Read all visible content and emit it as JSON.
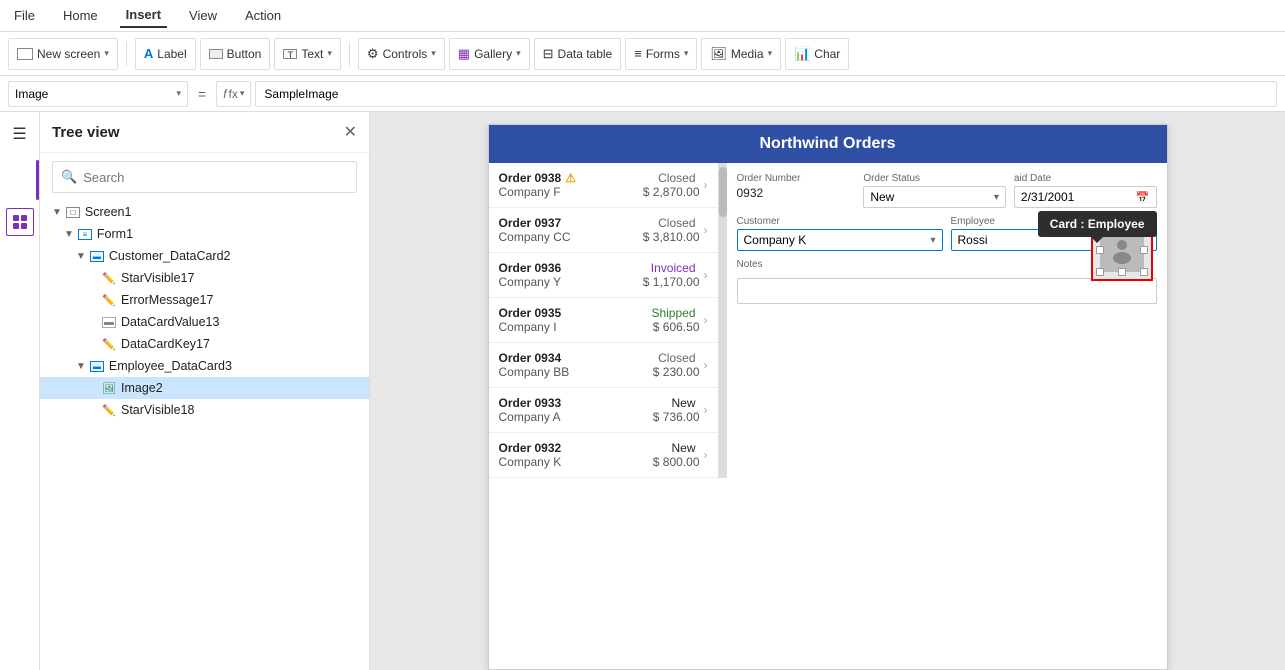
{
  "menuBar": {
    "items": [
      "File",
      "Home",
      "Insert",
      "View",
      "Action"
    ],
    "active": "Insert"
  },
  "toolbar": {
    "newScreen": "New screen",
    "label": "Label",
    "button": "Button",
    "text": "Text",
    "controls": "Controls",
    "gallery": "Gallery",
    "dataTable": "Data table",
    "forms": "Forms",
    "media": "Media",
    "chart": "Char"
  },
  "formulaBar": {
    "selector": "Image",
    "equals": "=",
    "fx": "fx",
    "value": "SampleImage"
  },
  "treeView": {
    "title": "Tree view",
    "search": {
      "placeholder": "Search"
    },
    "items": [
      {
        "id": "screen1",
        "label": "Screen1",
        "indent": 1,
        "type": "screen",
        "expanded": true
      },
      {
        "id": "form1",
        "label": "Form1",
        "indent": 2,
        "type": "form",
        "expanded": true
      },
      {
        "id": "customer_datacard2",
        "label": "Customer_DataCard2",
        "indent": 3,
        "type": "datacard",
        "expanded": true
      },
      {
        "id": "starvisible17",
        "label": "StarVisible17",
        "indent": 4,
        "type": "pencil"
      },
      {
        "id": "errormessage17",
        "label": "ErrorMessage17",
        "indent": 4,
        "type": "pencil"
      },
      {
        "id": "datacardvalue13",
        "label": "DataCardValue13",
        "indent": 4,
        "type": "textfield"
      },
      {
        "id": "datacardkey17",
        "label": "DataCardKey17",
        "indent": 4,
        "type": "pencil"
      },
      {
        "id": "employee_datacard3",
        "label": "Employee_DataCard3",
        "indent": 3,
        "type": "datacard",
        "expanded": true
      },
      {
        "id": "image2",
        "label": "Image2",
        "indent": 4,
        "type": "image",
        "active": true
      },
      {
        "id": "starvisible18",
        "label": "StarVisible18",
        "indent": 4,
        "type": "pencil"
      }
    ]
  },
  "app": {
    "title": "Northwind Orders",
    "orders": [
      {
        "num": "Order 0938",
        "company": "Company F",
        "status": "Closed",
        "statusClass": "closed",
        "amount": "$ 2,870.00",
        "warn": true
      },
      {
        "num": "Order 0937",
        "company": "Company CC",
        "status": "Closed",
        "statusClass": "closed",
        "amount": "$ 3,810.00",
        "warn": false
      },
      {
        "num": "Order 0936",
        "company": "Company Y",
        "status": "Invoiced",
        "statusClass": "invoiced",
        "amount": "$ 1,170.00",
        "warn": false
      },
      {
        "num": "Order 0935",
        "company": "Company I",
        "status": "Shipped",
        "statusClass": "shipped",
        "amount": "$ 606.50",
        "warn": false
      },
      {
        "num": "Order 0934",
        "company": "Company BB",
        "status": "Closed",
        "statusClass": "closed",
        "amount": "$ 230.00",
        "warn": false
      },
      {
        "num": "Order 0933",
        "company": "Company A",
        "status": "New",
        "statusClass": "new",
        "amount": "$ 736.00",
        "warn": false
      },
      {
        "num": "Order 0932",
        "company": "Company K",
        "status": "New",
        "statusClass": "new",
        "amount": "$ 800.00",
        "warn": false
      }
    ],
    "form": {
      "orderNumberLabel": "Order Number",
      "orderNumberValue": "0932",
      "orderStatusLabel": "Order Status",
      "orderStatusValue": "New",
      "paidDateLabel": "aid Date",
      "paidDateValue": "2/31/2001",
      "customerLabel": "Customer",
      "customerValue": "Company K",
      "employeeLabel": "Employee",
      "employeeValue": "Rossi",
      "notesLabel": "Notes"
    },
    "tooltip": "Card : Employee"
  },
  "icons": {
    "hamburger": "☰",
    "layers": "⊞",
    "newScreen": "□",
    "label": "A",
    "button": "⬜",
    "text": "T",
    "controls": "⚙",
    "gallery": "▦",
    "dataTable": "⊟",
    "forms": "≡",
    "media": "🖼",
    "chart": "📊",
    "search": "🔍",
    "close": "✕",
    "expand": "▼",
    "collapse": "▶",
    "chevron": "›",
    "arrow": "❯",
    "warn": "⚠"
  }
}
